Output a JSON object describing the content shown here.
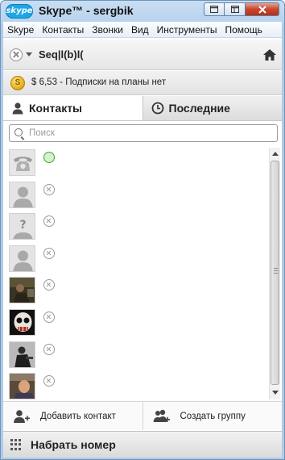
{
  "window": {
    "logo": "skype",
    "title": "Skype™ - sergbik",
    "controls": [
      "restore-icon",
      "minimize-icon",
      "close-icon"
    ]
  },
  "menu": {
    "items": [
      "Skype",
      "Контакты",
      "Звонки",
      "Вид",
      "Инструменты",
      "Помощь"
    ]
  },
  "profile": {
    "status_icon": "offline-status-icon",
    "name": "Seq|l(b)l(",
    "home_icon": "home-icon"
  },
  "credit": {
    "coin_symbol": "S",
    "text": "$ 6,53 - Подписки на планы нет"
  },
  "tabs": [
    {
      "label": "Контакты",
      "icon": "person-icon",
      "active": true
    },
    {
      "label": "Последние",
      "icon": "clock-icon",
      "active": false
    }
  ],
  "search": {
    "placeholder": "Поиск",
    "value": ""
  },
  "contacts": [
    {
      "avatar": "phone-avatar",
      "status": "phone"
    },
    {
      "avatar": "default-avatar",
      "status": "offline"
    },
    {
      "avatar": "unknown-avatar",
      "status": "offline"
    },
    {
      "avatar": "default-avatar",
      "status": "offline"
    },
    {
      "avatar": "photo-avatar",
      "status": "offline"
    },
    {
      "avatar": "skull-avatar",
      "status": "offline"
    },
    {
      "avatar": "photo-avatar",
      "status": "offline"
    },
    {
      "avatar": "photo-avatar",
      "status": "offline"
    }
  ],
  "actions": {
    "add_contact": "Добавить контакт",
    "create_group": "Создать группу"
  },
  "dial": {
    "label": "Набрать номер"
  },
  "colors": {
    "frame_blue": "#b9d3ee",
    "skype_blue": "#1ba7e5",
    "close_red": "#c8452e",
    "online_green": "#3aa82e"
  }
}
